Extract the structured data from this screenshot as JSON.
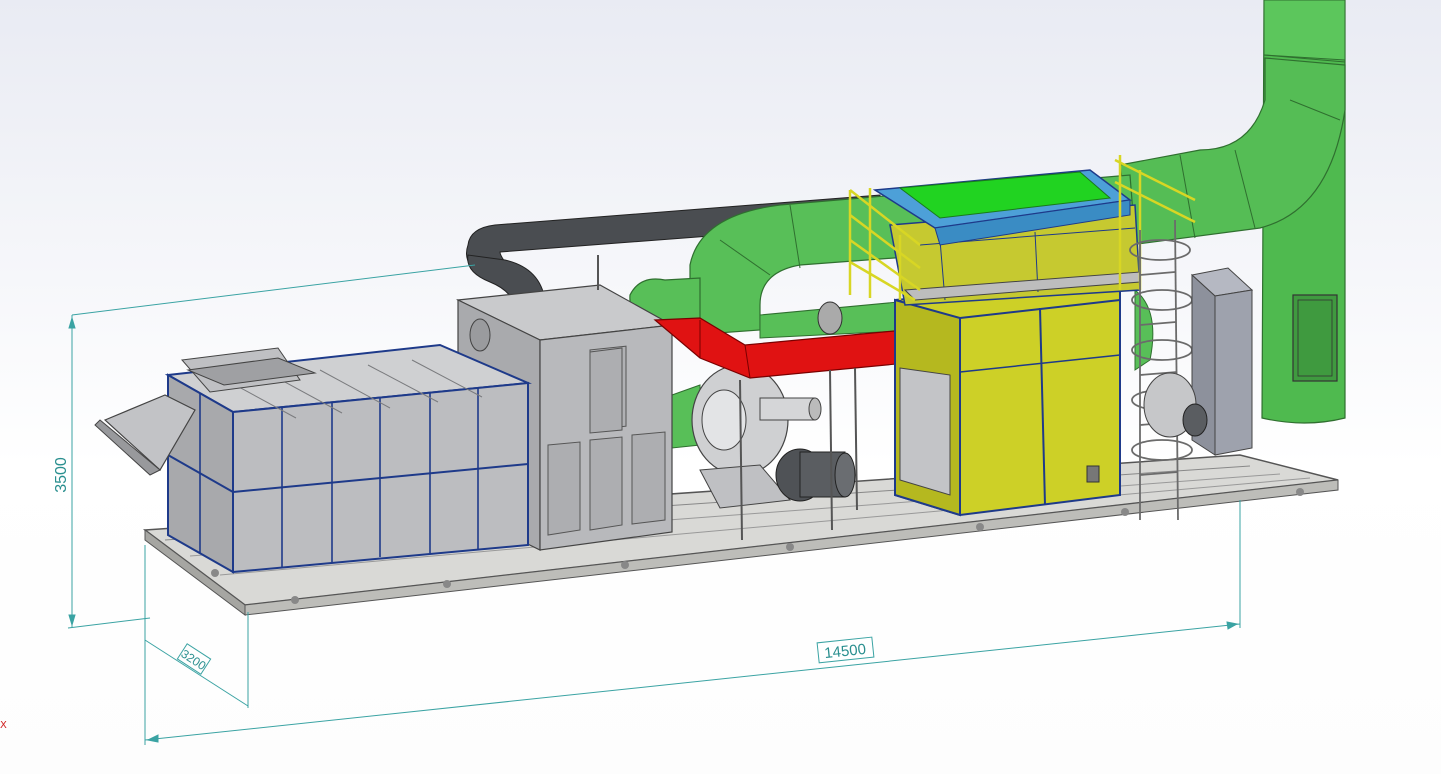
{
  "dimensions": {
    "height": "3500",
    "width": "3200",
    "length": "14500"
  },
  "axis_indicator": "X",
  "colors": {
    "dimension_line": "#3aa3a3",
    "green_duct": "#4fba4f",
    "red_duct": "#e01212",
    "gray_duct": "#4a4d51",
    "yellow_frame": "#cfd226",
    "housing_gray": "#b7b8bb",
    "blue_frame": "#1e3a8a",
    "roof_green": "#21d321",
    "roof_blue": "#4da0d8"
  }
}
